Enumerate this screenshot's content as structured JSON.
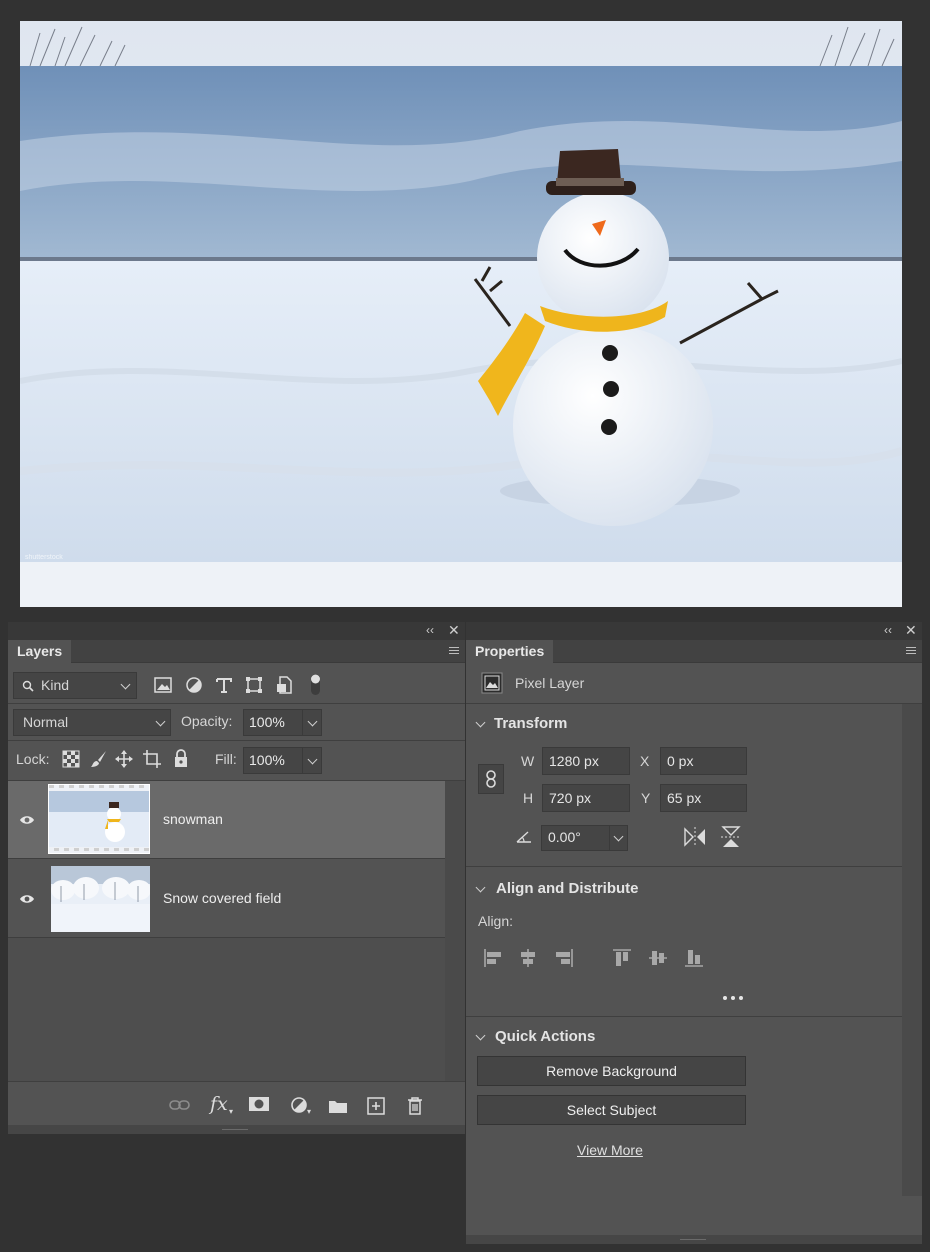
{
  "canvas": {
    "image_name": "snowman",
    "watermark": "shutterstock"
  },
  "layers_panel": {
    "title": "Layers",
    "filter_kind": "Kind",
    "blend_mode": "Normal",
    "opacity_label": "Opacity:",
    "opacity_value": "100%",
    "lock_label": "Lock:",
    "fill_label": "Fill:",
    "fill_value": "100%",
    "layers": [
      {
        "name": "snowman",
        "visible": true,
        "selected": true
      },
      {
        "name": "Snow covered field",
        "visible": true,
        "selected": false
      }
    ]
  },
  "properties_panel": {
    "title": "Properties",
    "layer_type": "Pixel Layer",
    "transform": {
      "title": "Transform",
      "w_label": "W",
      "w_value": "1280 px",
      "h_label": "H",
      "h_value": "720 px",
      "x_label": "X",
      "x_value": "0 px",
      "y_label": "Y",
      "y_value": "65 px",
      "angle_value": "0.00°"
    },
    "align": {
      "title": "Align and Distribute",
      "align_label": "Align:"
    },
    "quick_actions": {
      "title": "Quick Actions",
      "remove_bg": "Remove Background",
      "select_subject": "Select Subject",
      "view_more": "View More"
    }
  },
  "colors": {
    "panel_bg": "#535353",
    "app_bg": "#323232",
    "selected_layer": "#6a6a6a"
  }
}
